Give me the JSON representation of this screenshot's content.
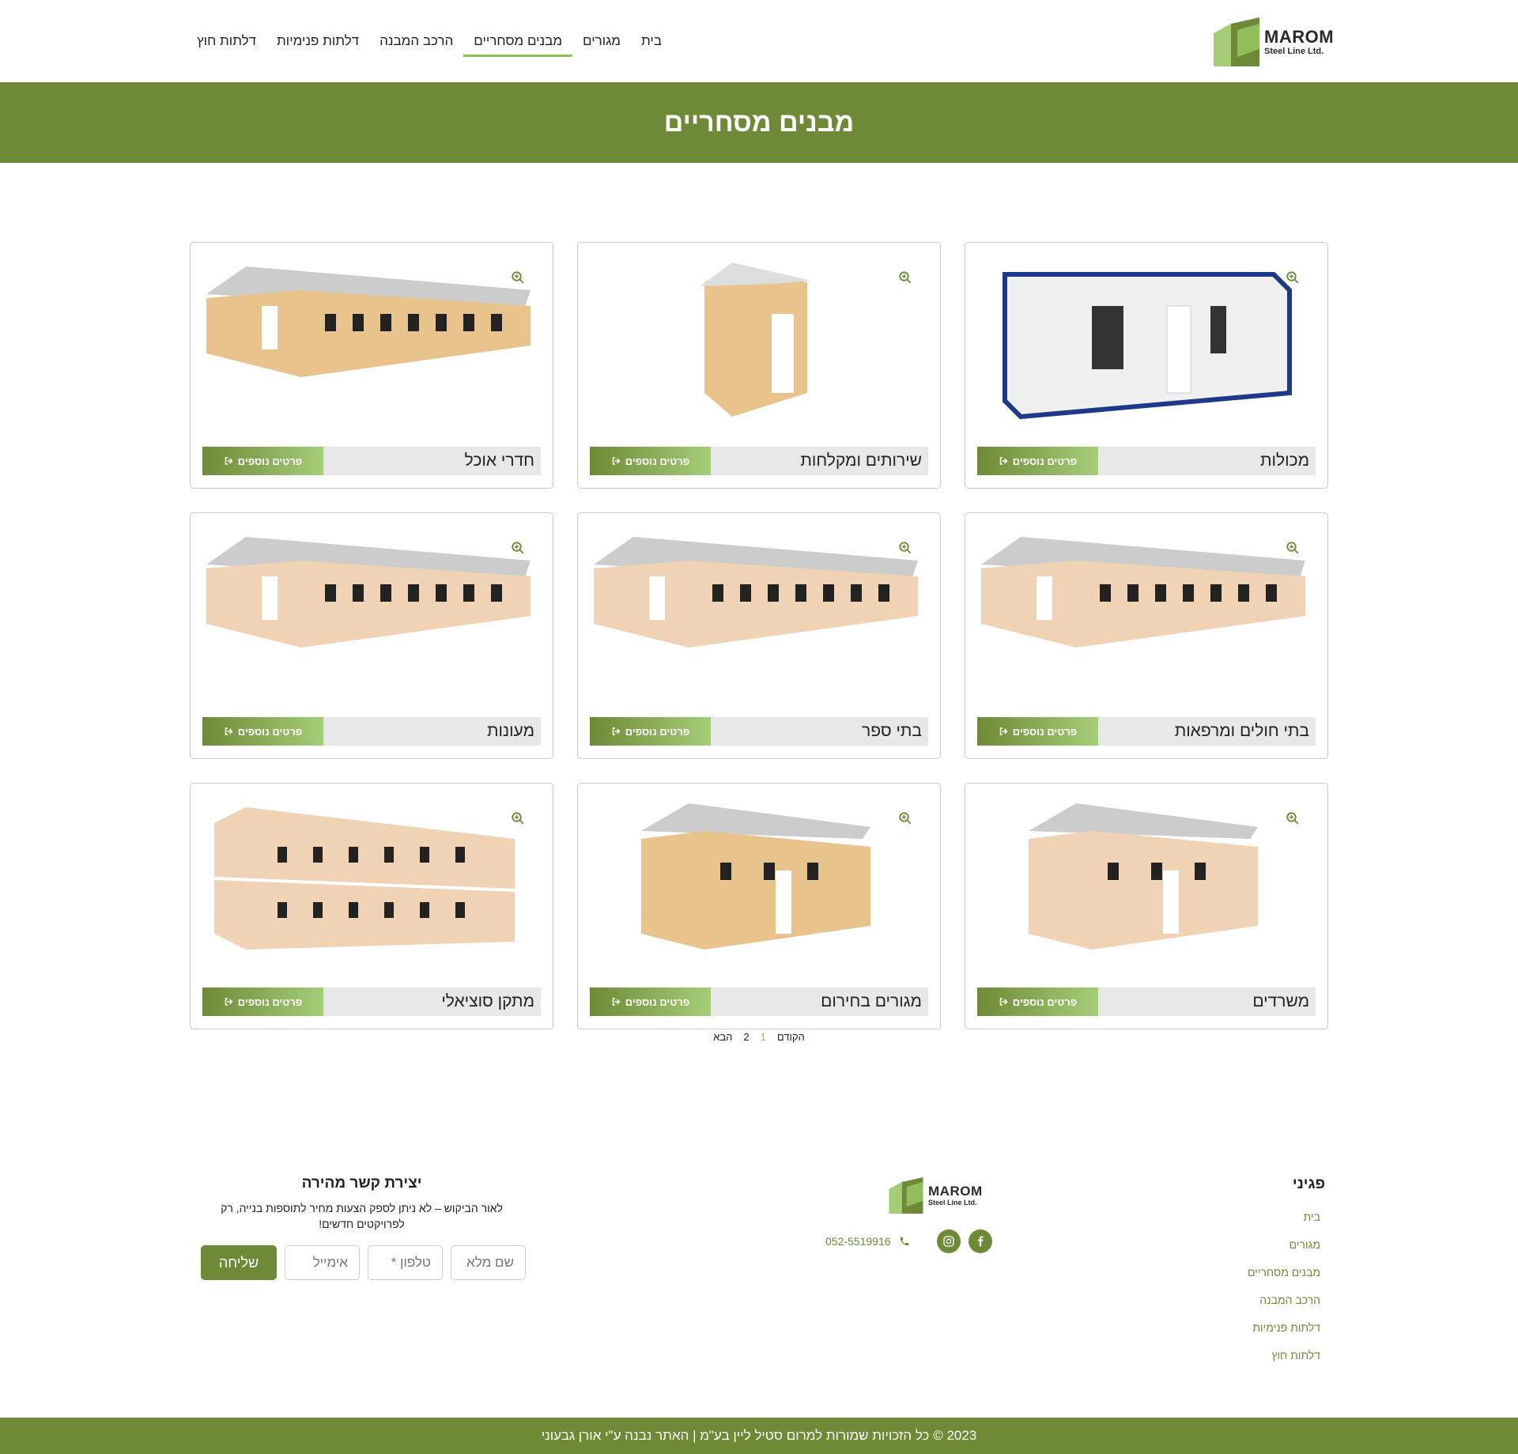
{
  "header": {
    "logo": {
      "name": "MAROM",
      "sub": "Steel Line Ltd."
    },
    "nav": [
      {
        "label": "בית",
        "active": false
      },
      {
        "label": "מגורים",
        "active": false
      },
      {
        "label": "מבנים מסחריים",
        "active": true
      },
      {
        "label": "הרכב המבנה",
        "active": false
      },
      {
        "label": "דלתות פנימיות",
        "active": false
      },
      {
        "label": "דלתות חוץ",
        "active": false
      }
    ]
  },
  "banner": {
    "title": "מבנים מסחריים"
  },
  "products": [
    {
      "title": "מכולות",
      "button": "פרטים נוספים",
      "style": "container"
    },
    {
      "title": "שירותים ומקלחות",
      "button": "פרטים נוספים",
      "style": "cabin"
    },
    {
      "title": "חדרי אוכל",
      "button": "פרטים נוספים",
      "style": "hall"
    },
    {
      "title": "בתי חולים ומרפאות",
      "button": "פרטים נוספים",
      "style": "long"
    },
    {
      "title": "בתי ספר",
      "button": "פרטים נוספים",
      "style": "school"
    },
    {
      "title": "מעונות",
      "button": "פרטים נוספים",
      "style": "long"
    },
    {
      "title": "משרדים",
      "button": "פרטים נוספים",
      "style": "office"
    },
    {
      "title": "מגורים בחירום",
      "button": "פרטים נוספים",
      "style": "hall2"
    },
    {
      "title": "מתקן סוציאלי",
      "button": "פרטים נוספים",
      "style": "twostory"
    }
  ],
  "pagination": {
    "prev": "הקודם",
    "pages": [
      "1",
      "2"
    ],
    "current": "1",
    "next": "הבא"
  },
  "footer": {
    "links_title": "פגיני",
    "links": [
      "בית",
      "מגורים",
      "מבנים מסחריים",
      "הרכב המבנה",
      "דלתות פנימיות",
      "דלתות חוץ"
    ],
    "phone": "052-5519916",
    "contact_title": "יצירת קשר מהירה",
    "contact_text": "לאור הביקוש – לא ניתן לספק הצעות מחיר לתוספות בנייה, רק לפרויקטים חדשים!",
    "form": {
      "name_placeholder": "שם מלא",
      "phone_placeholder": "טלפון *",
      "email_placeholder": "אימייל",
      "submit": "שליחה"
    },
    "copyright": "2023 © כל הזכויות שמורות למרום סטיל ליין בע\"מ | האתר נבנה ע\"י אורן גבעוני"
  },
  "colors": {
    "brand": "#6e8a36",
    "accent": "#8fbe5a",
    "card_bar": "#e8e8e8"
  }
}
